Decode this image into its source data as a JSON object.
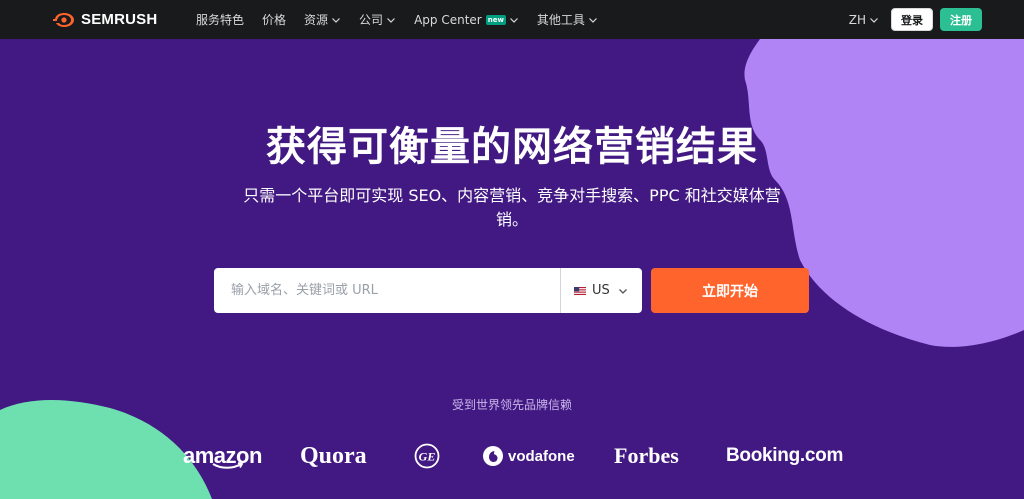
{
  "nav": {
    "logo_text": "SEMRUSH",
    "items": [
      {
        "label": "服务特色",
        "has_dropdown": false
      },
      {
        "label": "价格",
        "has_dropdown": false
      },
      {
        "label": "资源",
        "has_dropdown": true
      },
      {
        "label": "公司",
        "has_dropdown": true
      },
      {
        "label": "App Center",
        "badge": "new",
        "has_dropdown": true
      },
      {
        "label": "其他工具",
        "has_dropdown": true
      }
    ],
    "language": "ZH",
    "login_label": "登录",
    "signup_label": "注册"
  },
  "hero": {
    "title": "获得可衡量的网络营销结果",
    "subtitle": "只需一个平台即可实现 SEO、内容营销、竞争对手搜索、PPC 和社交媒体营销。"
  },
  "search": {
    "placeholder": "输入域名、关键词或 URL",
    "value": "",
    "country": "US",
    "cta_label": "立即开始"
  },
  "trusted": {
    "label": "受到世界领先品牌信赖",
    "brands": [
      "amazon",
      "Quora",
      "GE",
      "vodafone",
      "Forbes",
      "Booking.com"
    ]
  },
  "colors": {
    "nav_bg": "#181a1b",
    "hero_bg": "#421983",
    "purple_circle": "#b084f5",
    "green_circle": "#6ee0b0",
    "cta": "#ff642d",
    "signup": "#2dbf94",
    "badge_new": "#009f81"
  },
  "icons": {
    "logo": "semrush-fire-icon",
    "dropdown": "chevron-down-icon",
    "flag": "us-flag-icon"
  }
}
